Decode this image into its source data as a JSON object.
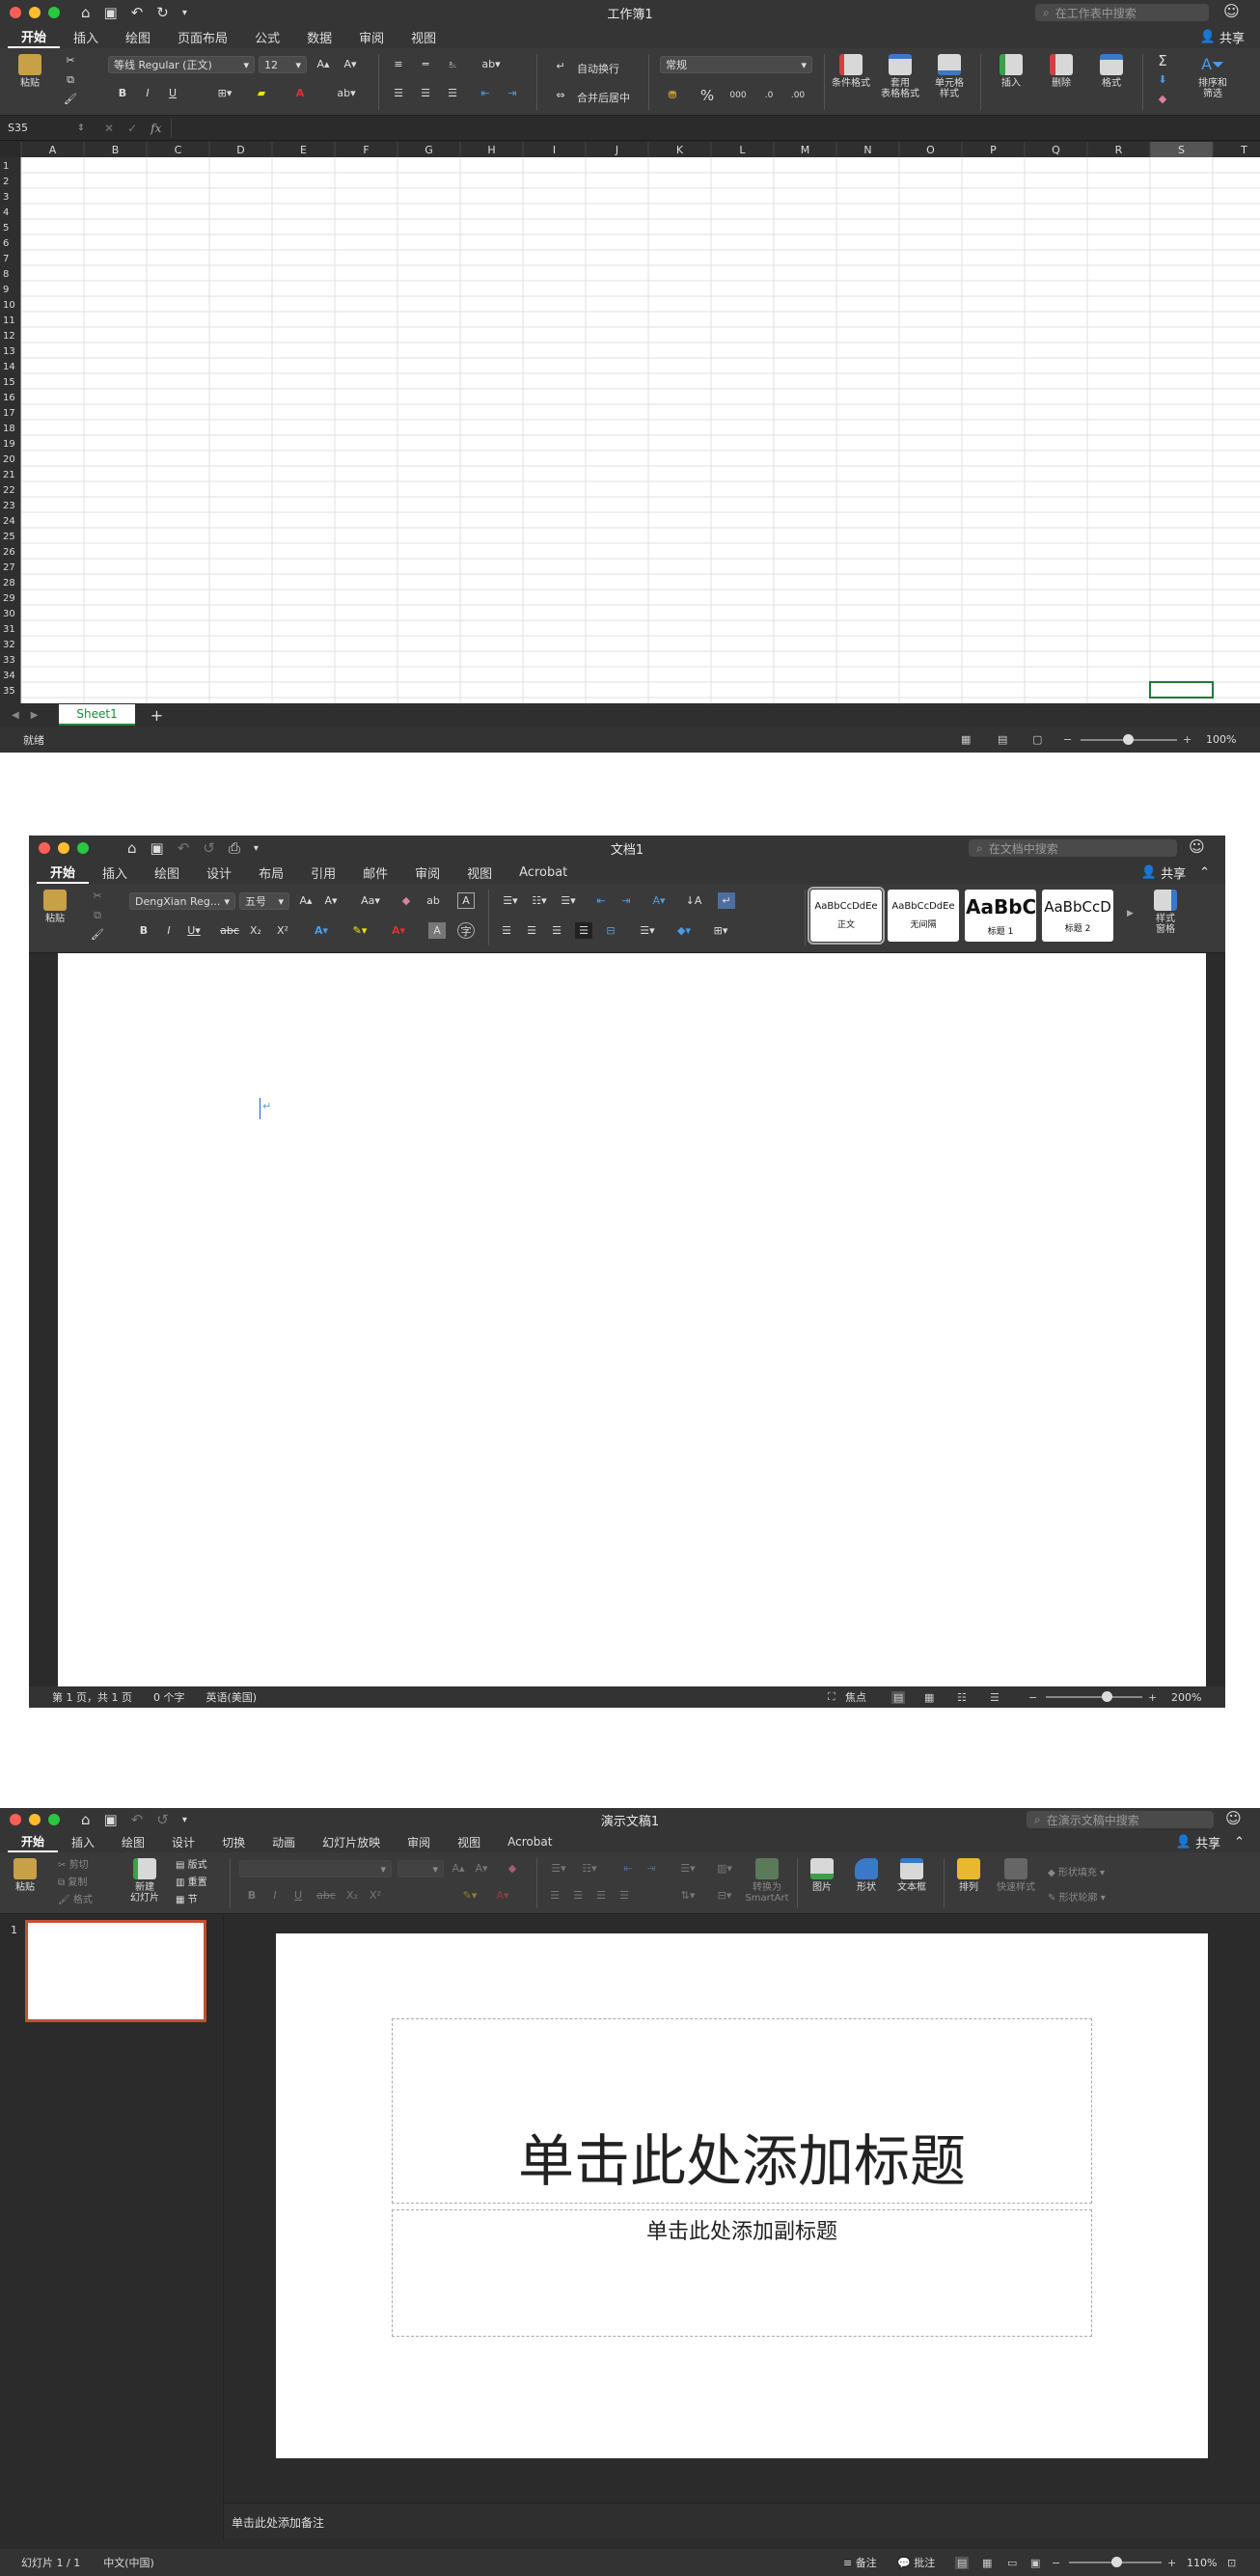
{
  "excel": {
    "title": "工作簿1",
    "search_placeholder": "在工作表中搜索",
    "share_label": "共享",
    "tabs": [
      "开始",
      "插入",
      "绘图",
      "页面布局",
      "公式",
      "数据",
      "审阅",
      "视图"
    ],
    "ribbon": {
      "paste": "粘贴",
      "font_name": "等线 Regular (正文)",
      "font_size": "12",
      "wrap_text": "自动换行",
      "merge_center": "合并后居中",
      "number_format": "常规",
      "cond_format": "条件格式",
      "table_format": "套用\n表格格式",
      "cell_style": "单元格\n样式",
      "insert": "插入",
      "delete": "删除",
      "format": "格式",
      "sort_filter": "排序和\n筛选"
    },
    "name_box": "S35",
    "fx": "fx",
    "columns": [
      "A",
      "B",
      "C",
      "D",
      "E",
      "F",
      "G",
      "H",
      "I",
      "J",
      "K",
      "L",
      "M",
      "N",
      "O",
      "P",
      "Q",
      "R",
      "S",
      "T"
    ],
    "rows": [
      "1",
      "2",
      "3",
      "4",
      "5",
      "6",
      "7",
      "8",
      "9",
      "10",
      "11",
      "12",
      "13",
      "14",
      "15",
      "16",
      "17",
      "18",
      "19",
      "20",
      "21",
      "22",
      "23",
      "24",
      "25",
      "26",
      "27",
      "28",
      "29",
      "30",
      "31",
      "32",
      "33",
      "34",
      "35"
    ],
    "sheet_tab": "Sheet1",
    "add_sheet": "+",
    "status": "就绪",
    "zoom": "100%"
  },
  "word": {
    "title": "文档1",
    "search_placeholder": "在文档中搜索",
    "share_label": "共享",
    "tabs": [
      "开始",
      "插入",
      "绘图",
      "设计",
      "布局",
      "引用",
      "邮件",
      "审阅",
      "视图",
      "Acrobat"
    ],
    "ribbon": {
      "paste": "粘贴",
      "font_name": "DengXian Reg...",
      "font_size": "五号",
      "styles": [
        {
          "preview": "AaBbCcDdEe",
          "name": "正文"
        },
        {
          "preview": "AaBbCcDdEe",
          "name": "无间隔"
        },
        {
          "preview": "AaBbC",
          "name": "标题 1"
        },
        {
          "preview": "AaBbCcD",
          "name": "标题 2"
        }
      ],
      "styles_pane": "样式\n窗格"
    },
    "status": {
      "page": "第 1 页，共 1 页",
      "words": "0 个字",
      "lang": "英语(美国)",
      "focus": "焦点",
      "zoom": "200%"
    }
  },
  "ppt": {
    "title": "演示文稿1",
    "search_placeholder": "在演示文稿中搜索",
    "share_label": "共享",
    "tabs": [
      "开始",
      "插入",
      "绘图",
      "设计",
      "切换",
      "动画",
      "幻灯片放映",
      "审阅",
      "视图",
      "Acrobat"
    ],
    "ribbon": {
      "paste": "粘贴",
      "cut": "剪切",
      "copy": "复制",
      "format": "格式",
      "new_slide": "新建\n幻灯片",
      "layout": "版式",
      "reset": "重置",
      "section": "节",
      "smartart": "转换为\nSmartArt",
      "picture": "图片",
      "shape": "形状",
      "textbox": "文本框",
      "arrange": "排列",
      "quick_style": "快速样式",
      "shape_fill": "形状填充",
      "shape_outline": "形状轮廓"
    },
    "slide_number": "1",
    "title_placeholder": "单击此处添加标题",
    "subtitle_placeholder": "单击此处添加副标题",
    "notes_placeholder": "单击此处添加备注",
    "status": {
      "slide": "幻灯片 1 / 1",
      "lang": "中文(中国)",
      "notes": "备注",
      "comments": "批注",
      "zoom": "110%"
    }
  }
}
